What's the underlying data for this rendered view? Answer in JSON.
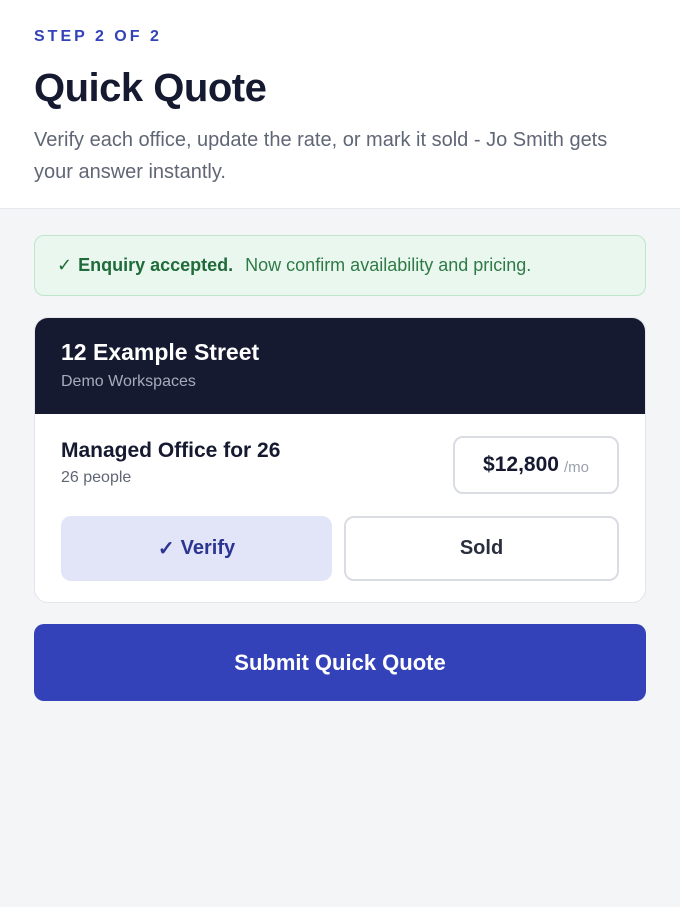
{
  "header": {
    "step": "STEP 2 OF 2",
    "title": "Quick Quote",
    "subtitle": "Verify each office, update the rate, or mark it sold - Jo Smith gets your answer instantly."
  },
  "alert": {
    "icon": "check-icon",
    "strong": "Enquiry accepted.",
    "text": "Now confirm availability and pricing.",
    "check_glyph": "✓"
  },
  "property": {
    "address": "12 Example Street",
    "provider": "Demo Workspaces",
    "offices": [
      {
        "name": "Managed Office for 26",
        "people": "26 people",
        "price": "$12,800",
        "price_unit": "/mo",
        "verify_label": "Verify",
        "sold_label": "Sold"
      }
    ]
  },
  "submit_label": "Submit Quick Quote",
  "colors": {
    "accent": "#3342b8",
    "dark": "#151a30",
    "success": "#1f6b3a",
    "success_bg": "#e9f7ee"
  }
}
